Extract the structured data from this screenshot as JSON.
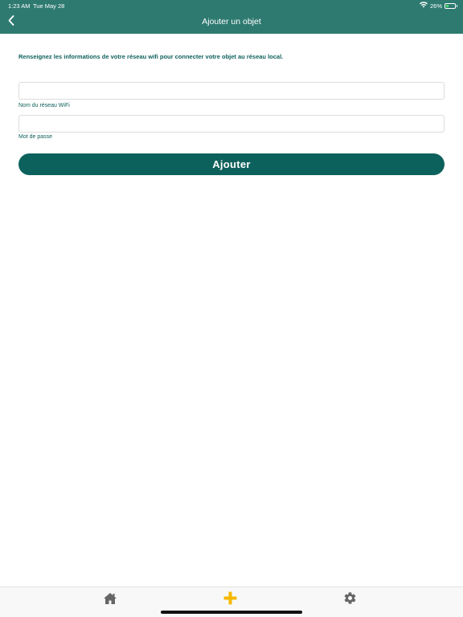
{
  "status_bar": {
    "time": "1:23 AM",
    "date": "Tue May 28",
    "battery": "26%",
    "battery_level": 0.26
  },
  "nav": {
    "title": "Ajouter un objet",
    "back_icon": "chevron-left-icon"
  },
  "form": {
    "intro": "Renseignez les informations de votre réseau wifi pour connecter votre objet au réseau local.",
    "ssid": {
      "value": "",
      "label": "Nom du réseau WiFi"
    },
    "password": {
      "value": "",
      "label": "Mot de passe"
    },
    "submit_label": "Ajouter"
  },
  "tabs": [
    {
      "icon": "home-icon",
      "active": false
    },
    {
      "icon": "plus-icon",
      "active": true
    },
    {
      "icon": "gear-icon",
      "active": false
    }
  ],
  "colors": {
    "header": "#2e7a70",
    "primary": "#0d615c",
    "accent": "#f5b800",
    "tab_icon": "#666666"
  }
}
